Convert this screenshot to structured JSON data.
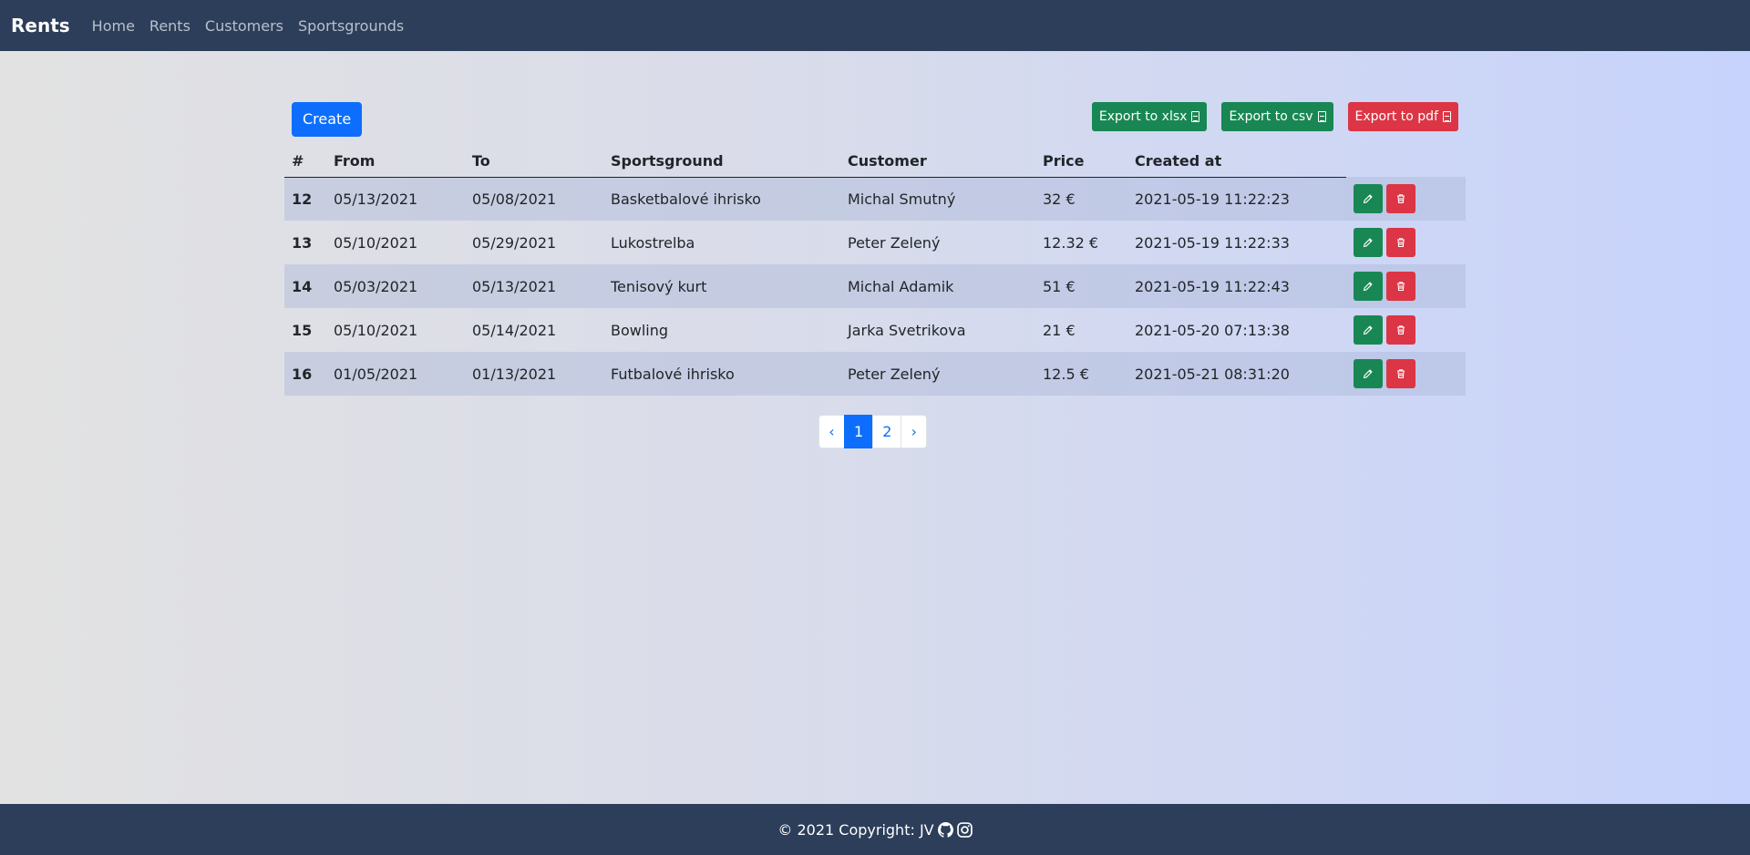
{
  "navbar": {
    "brand": "Rents",
    "links": [
      "Home",
      "Rents",
      "Customers",
      "Sportsgrounds"
    ]
  },
  "toolbar": {
    "create_label": "Create",
    "export_xlsx_label": "Export to xlsx",
    "export_csv_label": "Export to csv",
    "export_pdf_label": "Export to pdf"
  },
  "table": {
    "headers": [
      "#",
      "From",
      "To",
      "Sportsground",
      "Customer",
      "Price",
      "Created at"
    ],
    "rows": [
      {
        "id": "12",
        "from": "05/13/2021",
        "to": "05/08/2021",
        "sportsground": "Basketbalové ihrisko",
        "customer": "Michal Smutný",
        "price": "32 €",
        "created": "2021-05-19 11:22:23"
      },
      {
        "id": "13",
        "from": "05/10/2021",
        "to": "05/29/2021",
        "sportsground": "Lukostrelba",
        "customer": "Peter Zelený",
        "price": "12.32 €",
        "created": "2021-05-19 11:22:33"
      },
      {
        "id": "14",
        "from": "05/03/2021",
        "to": "05/13/2021",
        "sportsground": "Tenisový kurt",
        "customer": "Michal Adamik",
        "price": "51 €",
        "created": "2021-05-19 11:22:43"
      },
      {
        "id": "15",
        "from": "05/10/2021",
        "to": "05/14/2021",
        "sportsground": "Bowling",
        "customer": "Jarka Svetrikova",
        "price": "21 €",
        "created": "2021-05-20 07:13:38"
      },
      {
        "id": "16",
        "from": "01/05/2021",
        "to": "01/13/2021",
        "sportsground": "Futbalové ihrisko",
        "customer": "Peter Zelený",
        "price": "12.5 €",
        "created": "2021-05-21 08:31:20"
      }
    ]
  },
  "pagination": {
    "prev": "‹",
    "pages": [
      "1",
      "2"
    ],
    "active": "1",
    "next": "›"
  },
  "footer": {
    "text": "© 2021 Copyright: JV"
  },
  "colors": {
    "navbar": "#2c3e5a",
    "primary": "#0d6efd",
    "success": "#198754",
    "danger": "#dc3545"
  }
}
